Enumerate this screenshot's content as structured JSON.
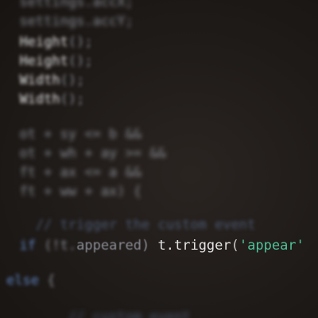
{
  "editor": {
    "theme": {
      "background": "#1f1b19",
      "plain": "#8a8c94",
      "keyword": "#5f86c2",
      "string": "#4fc29a",
      "comment": "#4a5870",
      "bright": "#e4e4e4",
      "punct": "#c8c8c8"
    },
    "lines": [
      {
        "id": "line-1",
        "blur": "b4",
        "tokens": [
          {
            "cls": "plain",
            "text": "  settings.accX;"
          }
        ]
      },
      {
        "id": "line-2",
        "blur": "b4",
        "tokens": [
          {
            "cls": "plain",
            "text": "  settings.accY;"
          }
        ]
      },
      {
        "id": "line-3",
        "blur": "b3",
        "tokens": [
          {
            "cls": "plain",
            "text": "  "
          },
          {
            "cls": "bright",
            "text": "Height"
          },
          {
            "cls": "plain",
            "text": "();"
          }
        ]
      },
      {
        "id": "line-4",
        "blur": "b3",
        "tokens": [
          {
            "cls": "plain",
            "text": "  "
          },
          {
            "cls": "bright",
            "text": "Height"
          },
          {
            "cls": "plain",
            "text": "();"
          }
        ]
      },
      {
        "id": "line-5",
        "blur": "b3",
        "tokens": [
          {
            "cls": "plain",
            "text": "  "
          },
          {
            "cls": "bright",
            "text": "Width"
          },
          {
            "cls": "plain",
            "text": "();"
          }
        ]
      },
      {
        "id": "line-6",
        "blur": "b3",
        "tokens": [
          {
            "cls": "plain",
            "text": "  "
          },
          {
            "cls": "bright",
            "text": "Width"
          },
          {
            "cls": "plain",
            "text": "();"
          }
        ]
      },
      {
        "id": "line-7",
        "blur": "b4",
        "tokens": [
          {
            "cls": "plain",
            "text": "  ot + sy <= b &&"
          }
        ]
      },
      {
        "id": "line-8",
        "blur": "b4",
        "tokens": [
          {
            "cls": "plain",
            "text": "  ot + wh + ay >= "
          },
          {
            "cls": "plain",
            "text": "&&"
          }
        ]
      },
      {
        "id": "line-9",
        "blur": "b4",
        "tokens": [
          {
            "cls": "plain",
            "text": "  ft + ax <= a &&"
          }
        ]
      },
      {
        "id": "line-10",
        "blur": "b4",
        "tokens": [
          {
            "cls": "plain",
            "text": "  ft + ww + ax) {"
          }
        ]
      },
      {
        "id": "line-11",
        "blur": "b3",
        "tokens": [
          {
            "cls": "comment",
            "text": "    // trigger the custom event"
          }
        ]
      },
      {
        "id": "line-12",
        "blur": "b0",
        "tokens": [
          {
            "cls": "keyword",
            "text": "  if ",
            "blur": "b3"
          },
          {
            "cls": "plain",
            "text": "(!t.",
            "blur": "b3"
          },
          {
            "cls": "plain",
            "text": "appeared) ",
            "blur": "b1"
          },
          {
            "cls": "bright",
            "text": "t."
          },
          {
            "cls": "bright",
            "text": "trigger"
          },
          {
            "cls": "punct",
            "text": "("
          },
          {
            "cls": "string",
            "text": "'appear'"
          }
        ]
      },
      {
        "id": "line-13",
        "blur": "b3",
        "tokens": [
          {
            "cls": "keyword",
            "text": "else "
          },
          {
            "cls": "plain",
            "text": "{"
          }
        ]
      },
      {
        "id": "line-14",
        "blur": "b5",
        "tokens": [
          {
            "cls": "plain",
            "text": "        "
          },
          {
            "cls": "comment",
            "text": "// custom event"
          }
        ]
      }
    ]
  }
}
